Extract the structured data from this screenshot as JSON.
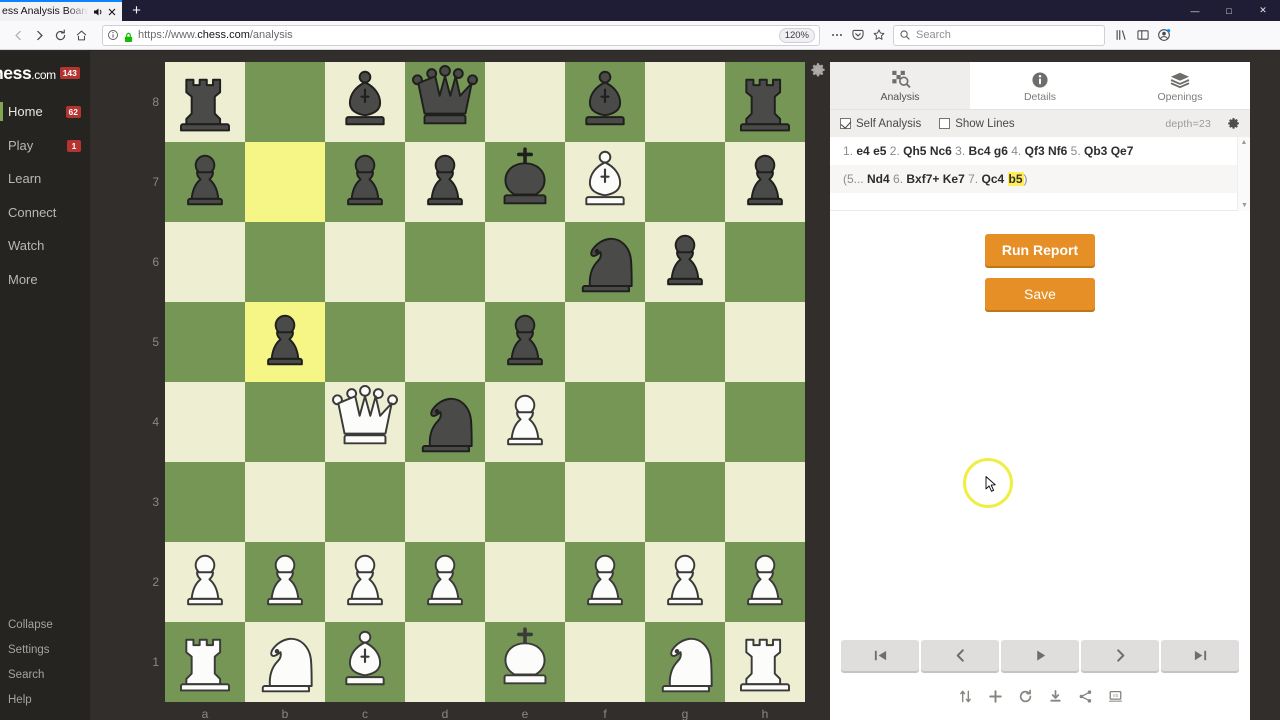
{
  "browser": {
    "tab_title": "ess Analysis Board and Pl",
    "new_tab_label": "+",
    "window_minimize": "—",
    "window_maximize": "□",
    "window_close": "✕",
    "url_protocol": "https://www.",
    "url_domain": "chess.com",
    "url_path": "/analysis",
    "zoom_level": "120%",
    "search_placeholder": "Search"
  },
  "sidebar": {
    "logo": "hess",
    "logo_suffix": ".com",
    "logo_badge": "143",
    "items": [
      {
        "label": "Home",
        "badge": "62",
        "active": true
      },
      {
        "label": "Play",
        "badge": "1",
        "active": false
      },
      {
        "label": "Learn",
        "badge": "",
        "active": false
      },
      {
        "label": "Connect",
        "badge": "",
        "active": false
      },
      {
        "label": "Watch",
        "badge": "",
        "active": false
      },
      {
        "label": "More",
        "badge": "",
        "active": false
      }
    ],
    "footer_items": [
      {
        "label": "Collapse"
      },
      {
        "label": "Settings"
      },
      {
        "label": "Search"
      },
      {
        "label": "Help"
      }
    ]
  },
  "board": {
    "files": [
      "a",
      "b",
      "c",
      "d",
      "e",
      "f",
      "g",
      "h"
    ],
    "ranks": [
      "8",
      "7",
      "6",
      "5",
      "4",
      "3",
      "2",
      "1"
    ],
    "light_color": "#eeeed2",
    "dark_color": "#769656",
    "highlight_color": "#f6f686",
    "highlighted_squares": [
      "b7",
      "b5"
    ],
    "orientation": "white",
    "position": {
      "a8": "br",
      "c8": "bb",
      "d8": "bq",
      "f8": "bb",
      "h8": "br",
      "a7": "bp",
      "c7": "bp",
      "d7": "bp",
      "e7": "bk",
      "f7": "wb",
      "h7": "bp",
      "f6": "bn",
      "g6": "bp",
      "b5": "bp",
      "e5": "bp",
      "c4": "wq",
      "d4": "bn",
      "e4": "wp",
      "a2": "wp",
      "b2": "wp",
      "c2": "wp",
      "d2": "wp",
      "f2": "wp",
      "g2": "wp",
      "h2": "wp",
      "a1": "wr",
      "b1": "wn",
      "c1": "wb",
      "e1": "wk",
      "g1": "wn",
      "h1": "wr"
    }
  },
  "panel": {
    "tabs": [
      {
        "label": "Analysis",
        "icon": "board-search-icon",
        "selected": true
      },
      {
        "label": "Details",
        "icon": "info-icon",
        "selected": false
      },
      {
        "label": "Openings",
        "icon": "book-stack-icon",
        "selected": false
      }
    ],
    "options": {
      "self_analysis_label": "Self Analysis",
      "self_analysis_checked": true,
      "show_lines_label": "Show Lines",
      "show_lines_checked": false,
      "depth_label": "depth=23"
    },
    "moves": {
      "main_line": [
        {
          "t": "1.",
          "bold": false
        },
        {
          "t": "e4",
          "bold": true
        },
        {
          "t": "e5",
          "bold": true
        },
        {
          "t": "2.",
          "bold": false
        },
        {
          "t": "Qh5",
          "bold": true
        },
        {
          "t": "Nc6",
          "bold": true
        },
        {
          "t": "3.",
          "bold": false
        },
        {
          "t": "Bc4",
          "bold": true
        },
        {
          "t": "g6",
          "bold": true
        },
        {
          "t": "4.",
          "bold": false
        },
        {
          "t": "Qf3",
          "bold": true
        },
        {
          "t": "Nf6",
          "bold": true
        },
        {
          "t": "5.",
          "bold": false
        },
        {
          "t": "Qb3",
          "bold": true
        },
        {
          "t": "Qe7",
          "bold": true
        }
      ],
      "variation_prefix": "(5...",
      "variation": [
        {
          "t": "Nd4",
          "bold": true
        },
        {
          "t": "6.",
          "bold": false
        },
        {
          "t": "Bxf7+",
          "bold": true
        },
        {
          "t": "Ke7",
          "bold": true
        },
        {
          "t": "7.",
          "bold": false
        },
        {
          "t": "Qc4",
          "bold": true
        }
      ],
      "variation_highlight": "b5",
      "variation_suffix": ")"
    },
    "buttons": {
      "run_report": "Run Report",
      "save": "Save",
      "accent_color": "#e58f26"
    },
    "nav_controls": [
      {
        "name": "first-move-button",
        "glyph": "|◀"
      },
      {
        "name": "previous-move-button",
        "glyph": "◀"
      },
      {
        "name": "play-button",
        "glyph": "▶"
      },
      {
        "name": "next-move-button",
        "glyph": "▶"
      },
      {
        "name": "last-move-button",
        "glyph": "▶|"
      }
    ],
    "tool_icons": [
      "flip-board-icon",
      "new-game-icon",
      "reload-icon",
      "download-icon",
      "share-icon",
      "play-computer-icon"
    ]
  }
}
